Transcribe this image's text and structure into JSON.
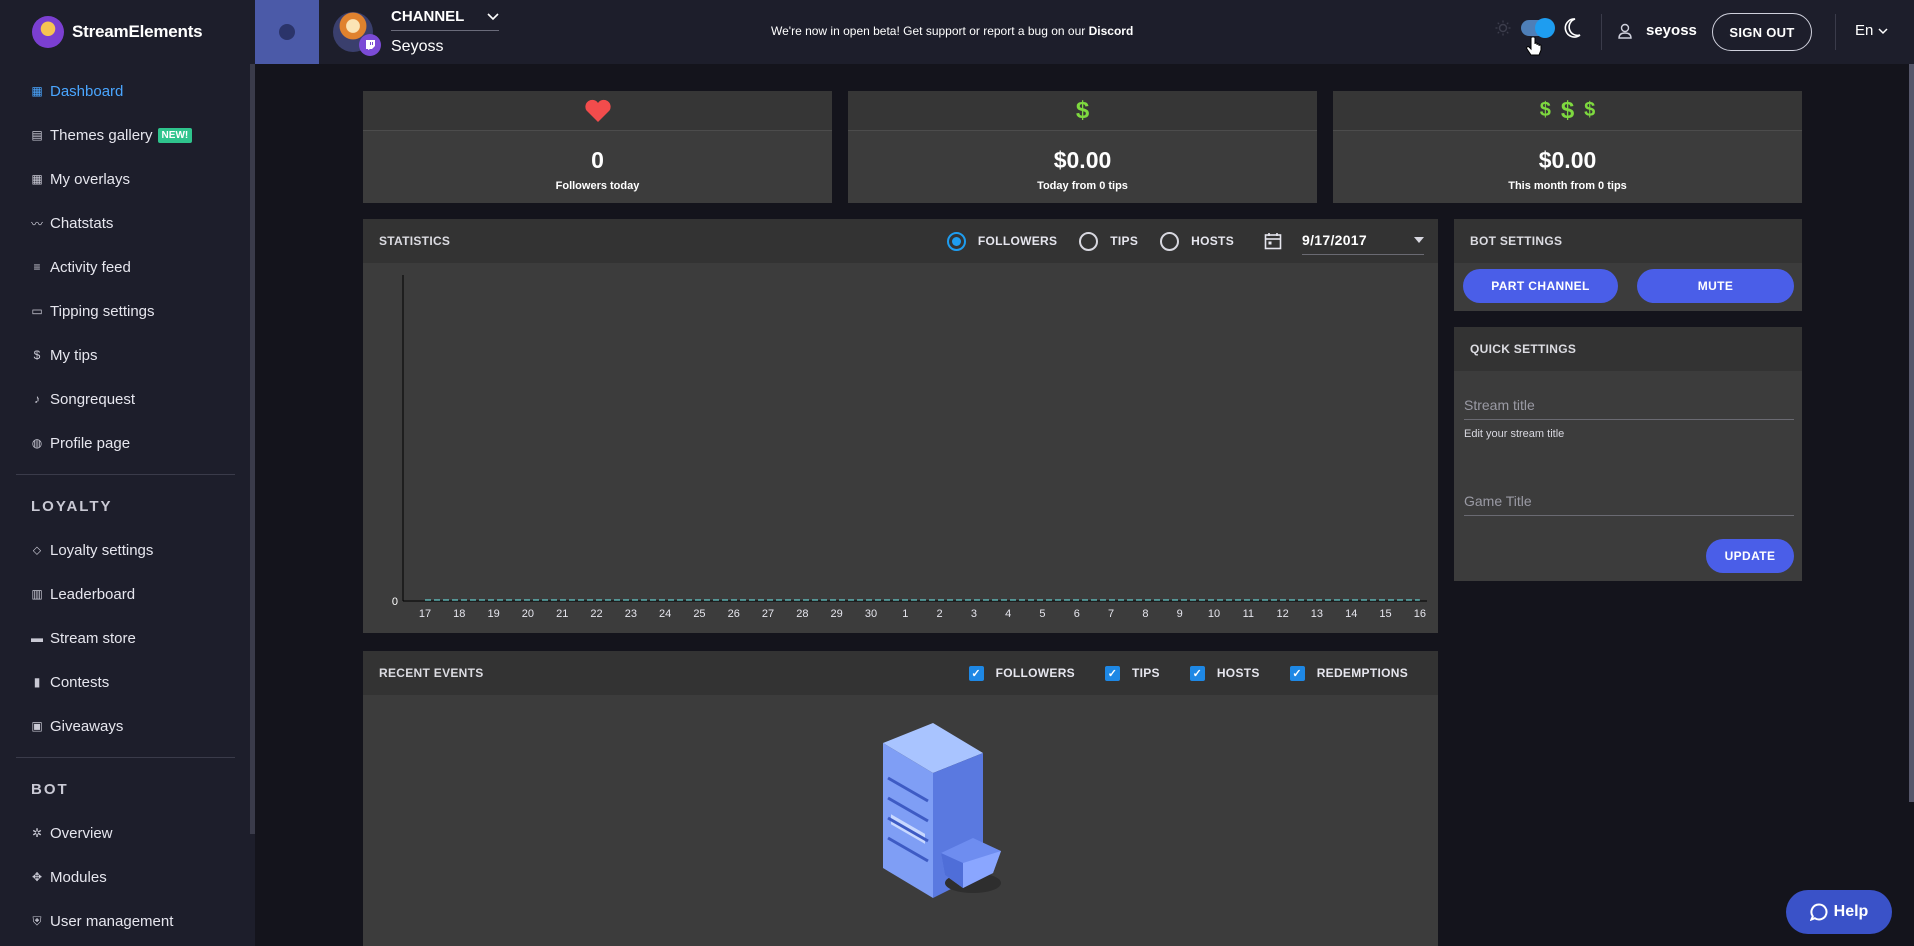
{
  "brand": {
    "name": "StreamElements"
  },
  "channel": {
    "label": "CHANNEL",
    "name": "Seyoss"
  },
  "banner": {
    "text": "We're now in open beta! Get support or report a bug on our ",
    "link": "Discord"
  },
  "user": {
    "name": "seyoss",
    "signout_label": "SIGN OUT",
    "language": "En"
  },
  "sidebar": {
    "items": [
      {
        "label": "Dashboard",
        "icon": "dashboard-icon",
        "active": true
      },
      {
        "label": "Themes gallery",
        "icon": "grid-icon",
        "badge": "NEW!"
      },
      {
        "label": "My overlays",
        "icon": "overlays-icon"
      },
      {
        "label": "Chatstats",
        "icon": "chart-line-icon"
      },
      {
        "label": "Activity feed",
        "icon": "list-icon"
      },
      {
        "label": "Tipping settings",
        "icon": "monitor-icon"
      },
      {
        "label": "My tips",
        "icon": "dollar-icon"
      },
      {
        "label": "Songrequest",
        "icon": "music-note-icon"
      },
      {
        "label": "Profile page",
        "icon": "globe-icon"
      }
    ],
    "loyalty_header": "LOYALTY",
    "loyalty_items": [
      {
        "label": "Loyalty settings",
        "icon": "tag-icon"
      },
      {
        "label": "Leaderboard",
        "icon": "leaderboard-icon"
      },
      {
        "label": "Stream store",
        "icon": "store-icon"
      },
      {
        "label": "Contests",
        "icon": "bar-chart-icon"
      },
      {
        "label": "Giveaways",
        "icon": "gift-icon"
      }
    ],
    "bot_header": "BOT",
    "bot_items": [
      {
        "label": "Overview",
        "icon": "gear-icon"
      },
      {
        "label": "Modules",
        "icon": "modules-icon"
      },
      {
        "label": "User management",
        "icon": "shield-icon"
      }
    ]
  },
  "stats": [
    {
      "value": "0",
      "label": "Followers today",
      "icon": "heart-icon"
    },
    {
      "value": "$0.00",
      "label": "Today from 0 tips",
      "icon": "dollar-icon"
    },
    {
      "value": "$0.00",
      "label": "This month from 0 tips",
      "icon": "triple-dollar-icon"
    }
  ],
  "statistics": {
    "title": "STATISTICS",
    "options": [
      "FOLLOWERS",
      "TIPS",
      "HOSTS"
    ],
    "selected": "FOLLOWERS",
    "date": "9/17/2017"
  },
  "chart_data": {
    "type": "line",
    "categories": [
      "17",
      "18",
      "19",
      "20",
      "21",
      "22",
      "23",
      "24",
      "25",
      "26",
      "27",
      "28",
      "29",
      "30",
      "1",
      "2",
      "3",
      "4",
      "5",
      "6",
      "7",
      "8",
      "9",
      "10",
      "11",
      "12",
      "13",
      "14",
      "15",
      "16"
    ],
    "series": [
      {
        "values": [
          0,
          0,
          0,
          0,
          0,
          0,
          0,
          0,
          0,
          0,
          0,
          0,
          0,
          0,
          0,
          0,
          0,
          0,
          0,
          0,
          0,
          0,
          0,
          0,
          0,
          0,
          0,
          0,
          0,
          0
        ]
      }
    ],
    "y_tick": "0",
    "colors": {
      "line": "#5fb3b3",
      "axis": "#000000"
    }
  },
  "bot_settings": {
    "title": "BOT SETTINGS",
    "part_label": "PART CHANNEL",
    "mute_label": "MUTE"
  },
  "quick_settings": {
    "title": "QUICK SETTINGS",
    "stream_title_placeholder": "Stream title",
    "stream_title_help": "Edit your stream title",
    "game_title_placeholder": "Game Title",
    "update_label": "UPDATE"
  },
  "recent_events": {
    "title": "RECENT EVENTS",
    "filters": [
      "FOLLOWERS",
      "TIPS",
      "HOSTS",
      "REDEMPTIONS"
    ]
  },
  "help": {
    "label": "Help"
  },
  "colors": {
    "accent": "#1e9df0",
    "button": "#4a5ee8",
    "money": "#7ed93f",
    "heart": "#f24c4c"
  }
}
